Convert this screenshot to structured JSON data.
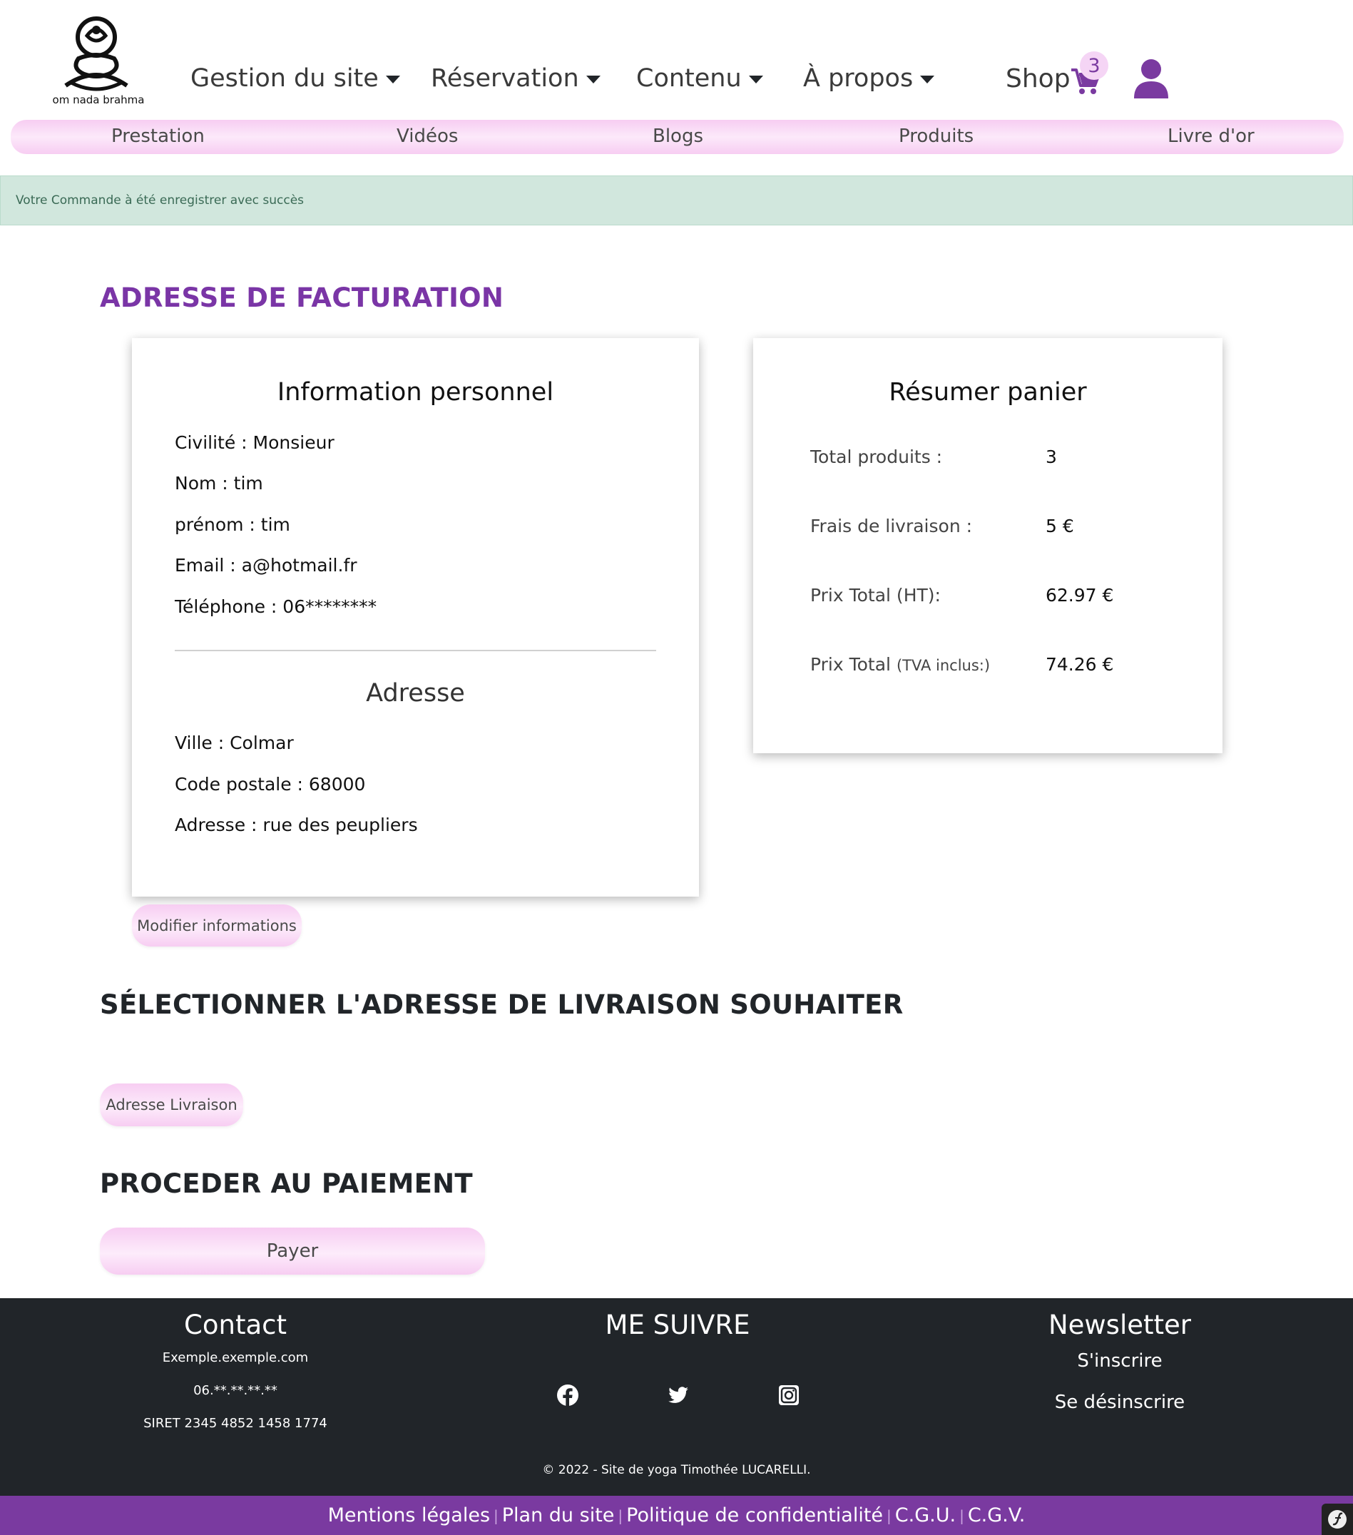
{
  "header": {
    "logo_text": "om nada brahma",
    "nav": [
      {
        "label": "Gestion du site"
      },
      {
        "label": "Réservation"
      },
      {
        "label": "Contenu"
      },
      {
        "label": "À propos"
      }
    ],
    "shop_label": "Shop",
    "cart_count": "3",
    "user_icon": "user-icon"
  },
  "subnav": [
    "Prestation",
    "Vidéos",
    "Blogs",
    "Produits",
    "Livre d'or"
  ],
  "alert": {
    "text": "Votre Commande à été enregistrer avec succès"
  },
  "billing": {
    "title": "ADRESSE DE FACTURATION",
    "info_card": {
      "title": "Information personnel",
      "lines": [
        "Civilité : Monsieur",
        "Nom : tim",
        "prénom : tim",
        "Email : a@hotmail.fr",
        "Téléphone : 06********"
      ],
      "address_title": "Adresse",
      "address_lines": [
        "Ville : Colmar",
        "Code postale : 68000",
        "Adresse : rue des peupliers"
      ]
    },
    "cart_card": {
      "title": "Résumer panier",
      "rows": [
        {
          "label": "Total produits :",
          "suffix": "",
          "value": "3"
        },
        {
          "label": "Frais de livraison :",
          "suffix": "",
          "value": "5 €"
        },
        {
          "label": "Prix Total (HT):",
          "suffix": "",
          "value": "62.97 €"
        },
        {
          "label": "Prix Total",
          "suffix": "(TVA inclus:)",
          "value": "74.26 €"
        }
      ]
    },
    "modify_button": "Modifier informations"
  },
  "delivery": {
    "title": "SÉLECTIONNER L'ADRESSE DE LIVRAISON SOUHAITER",
    "button": "Adresse Livraison"
  },
  "payment": {
    "title": "PROCEDER AU PAIEMENT",
    "button": "Payer"
  },
  "footer": {
    "contact": {
      "title": "Contact",
      "email": "Exemple.exemple.com",
      "phone": "06.**.**.**.**",
      "siret": "SIRET 2345 4852 1458 1774"
    },
    "social": {
      "title": "ME SUIVRE",
      "icons": [
        "facebook-icon",
        "twitter-icon",
        "instagram-icon"
      ]
    },
    "newsletter": {
      "title": "Newsletter",
      "subscribe": "S'inscrire",
      "unsubscribe": "Se désinscrire"
    },
    "copyright": "© 2022 - Site de yoga Timothée LUCARELLI.",
    "legal_links": [
      "Mentions légales",
      "Plan du site",
      "Politique de confidentialité",
      "C.G.U.",
      "C.G.V."
    ]
  },
  "colors": {
    "accent": "#7a3aa0",
    "pink": "#f7cdf2",
    "alert_bg": "#d1e7dd",
    "footer_bg": "#212529"
  }
}
